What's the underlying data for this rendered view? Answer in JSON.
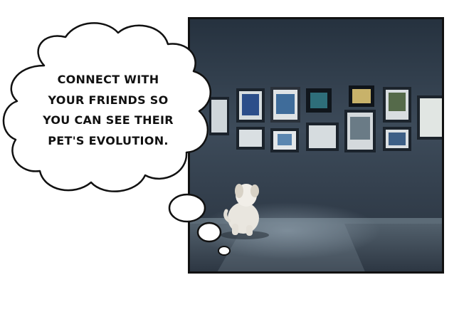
{
  "caption": {
    "lines": [
      "CONNECT WITH",
      "YOUR FRIENDS SO",
      "YOU CAN SEE THEIR",
      "PET'S EVOLUTION."
    ]
  },
  "scene": {
    "description_icon": "puppy-looking-at-picture-wall",
    "colors": {
      "wall_top": "#2e3b49",
      "wall_bottom": "#4a5868",
      "floor": "#3a4654",
      "frame_border": "#111111",
      "bubble_fill": "#ffffff",
      "bubble_stroke": "#111111"
    }
  }
}
